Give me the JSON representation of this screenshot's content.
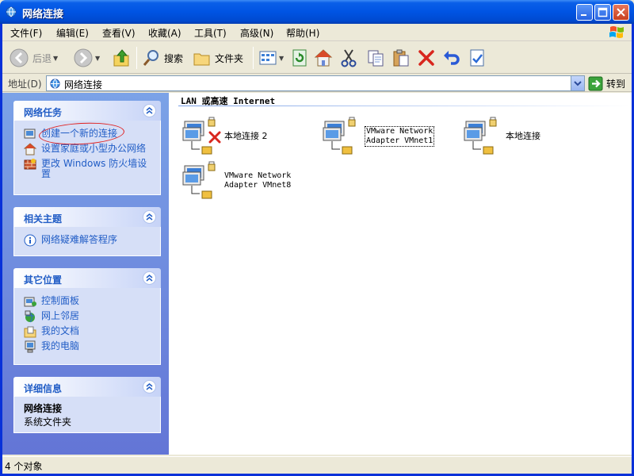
{
  "window": {
    "title": "网络连接",
    "controls": [
      "minimize",
      "maximize",
      "close"
    ]
  },
  "menubar": {
    "items": [
      "文件(F)",
      "编辑(E)",
      "查看(V)",
      "收藏(A)",
      "工具(T)",
      "高级(N)",
      "帮助(H)"
    ]
  },
  "toolbar": {
    "back_label": "后退",
    "search_label": "搜索",
    "folders_label": "文件夹"
  },
  "address": {
    "label": "地址(D)",
    "value": "网络连接",
    "go_label": "转到"
  },
  "taskpane": {
    "network_tasks": {
      "title": "网络任务",
      "items": [
        "创建一个新的连接",
        "设置家庭或小型办公网络",
        "更改 Windows 防火墙设置"
      ]
    },
    "related_topics": {
      "title": "相关主题",
      "items": [
        "网络疑难解答程序"
      ]
    },
    "other_places": {
      "title": "其它位置",
      "items": [
        "控制面板",
        "网上邻居",
        "我的文档",
        "我的电脑"
      ]
    },
    "details": {
      "title": "详细信息",
      "name": "网络连接",
      "type": "系统文件夹"
    }
  },
  "content": {
    "group_title": "LAN 或高速 Internet",
    "connections": [
      {
        "name": "本地连接 2",
        "status": "disconnected"
      },
      {
        "name_line1": "VMware Network",
        "name_line2": "Adapter VMnet1"
      },
      {
        "name": "本地连接"
      },
      {
        "name_line1": "VMware Network",
        "name_line2": "Adapter VMnet8"
      }
    ]
  },
  "statusbar": {
    "text": "4 个对象"
  },
  "colors": {
    "titlebar": "#0054e3",
    "taskpane_link": "#215dc6",
    "annotation": "#e02020"
  }
}
